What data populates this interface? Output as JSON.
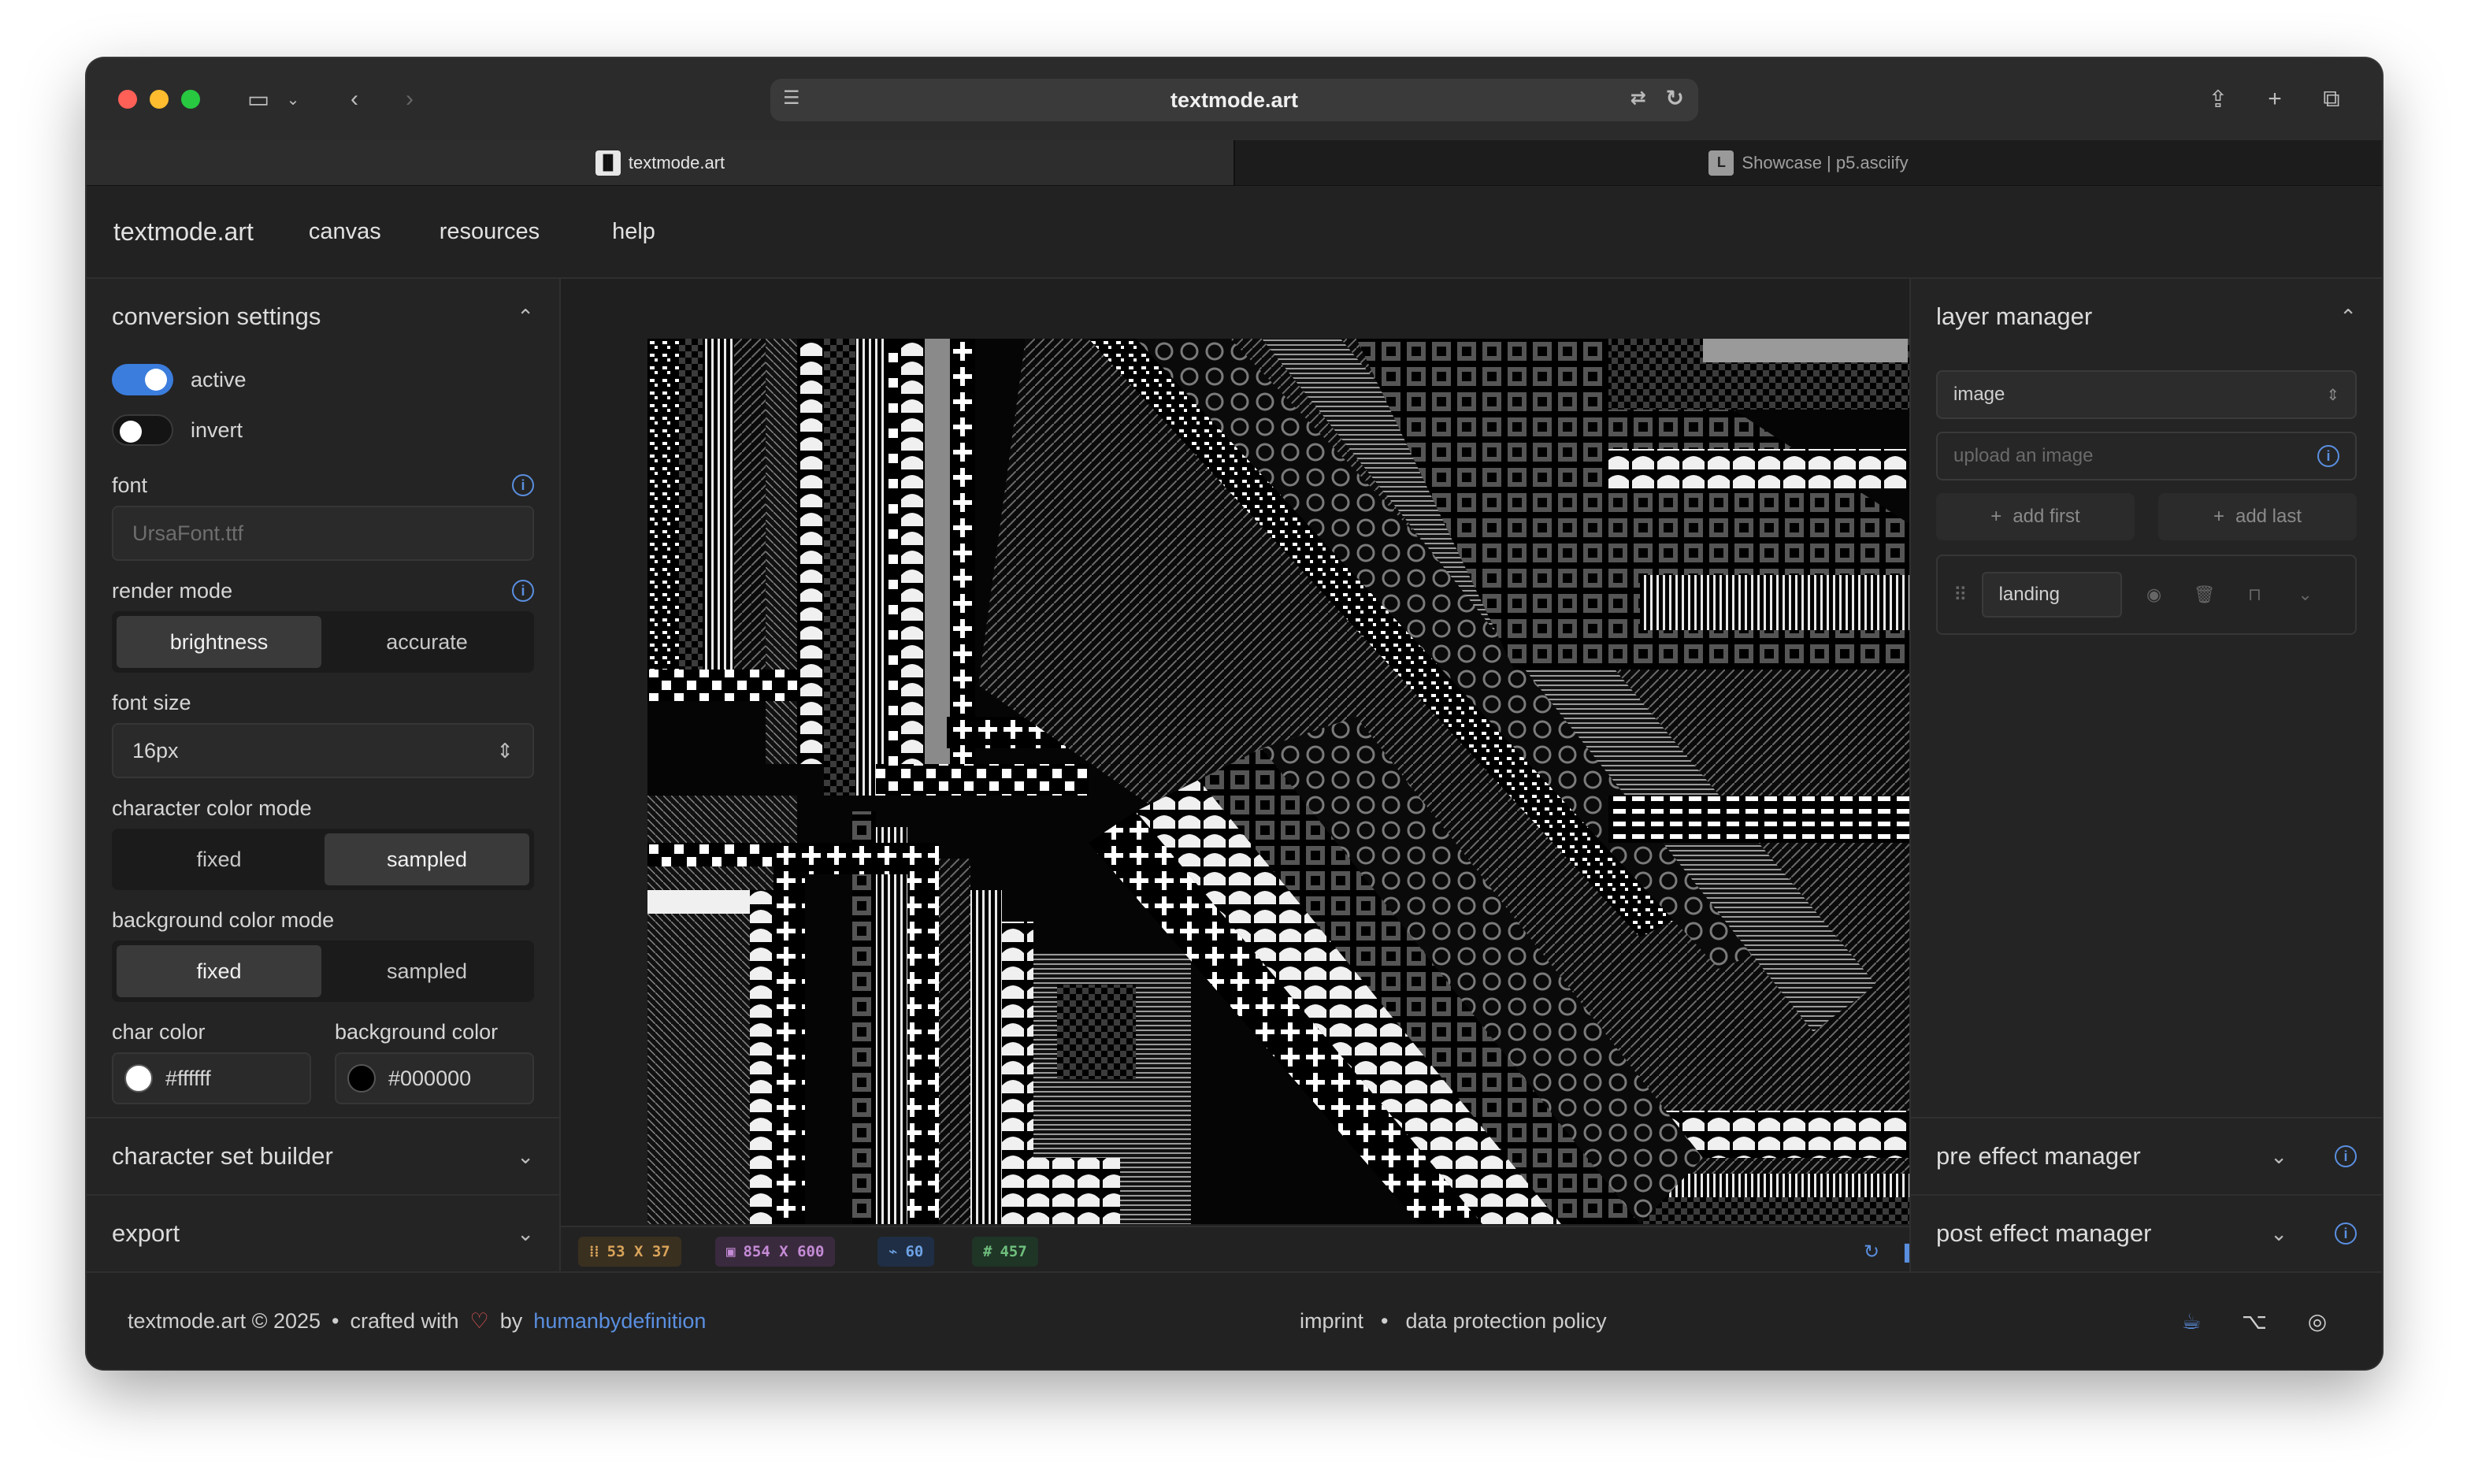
{
  "browser": {
    "url": "textmode.art",
    "tabs": [
      {
        "label": "textmode.art",
        "favicon": "▐▌"
      },
      {
        "label": "Showcase | p5.asciify",
        "favicon": "L"
      }
    ]
  },
  "nav": {
    "brand": "textmode.art",
    "links": [
      "canvas",
      "resources",
      "help"
    ]
  },
  "left": {
    "title": "conversion settings",
    "active_label": "active",
    "active_on": true,
    "invert_label": "invert",
    "invert_on": false,
    "font_label": "font",
    "font_placeholder": "UrsaFont.ttf",
    "render_mode_label": "render mode",
    "render_modes": [
      "brightness",
      "accurate"
    ],
    "render_mode_selected": "brightness",
    "font_size_label": "font size",
    "font_size_value": "16px",
    "char_color_mode_label": "character color mode",
    "char_color_modes": [
      "fixed",
      "sampled"
    ],
    "char_color_mode_selected": "sampled",
    "bg_color_mode_label": "background color mode",
    "bg_color_modes": [
      "fixed",
      "sampled"
    ],
    "bg_color_mode_selected": "fixed",
    "char_color_label": "char color",
    "char_color_value": "#ffffff",
    "bg_color_label": "background color",
    "bg_color_value": "#000000",
    "char_set_builder": "character set builder",
    "export": "export"
  },
  "status": {
    "grid": "53 X 37",
    "resolution": "854 X 600",
    "fps": "60",
    "chars": "457"
  },
  "right": {
    "title": "layer manager",
    "source_select": "image",
    "upload_placeholder": "upload an image",
    "add_first": "add first",
    "add_last": "add last",
    "layer_name": "landing",
    "pre_effect": "pre effect manager",
    "post_effect": "post effect manager"
  },
  "footer": {
    "copyright": "textmode.art © 2025",
    "crafted_with": "crafted with",
    "by": "by",
    "author": "humanbydefinition",
    "imprint": "imprint",
    "privacy": "data protection policy"
  },
  "colors": {
    "accent": "#3b7ddd",
    "link": "#5a8fe0",
    "heart": "#e05555"
  }
}
